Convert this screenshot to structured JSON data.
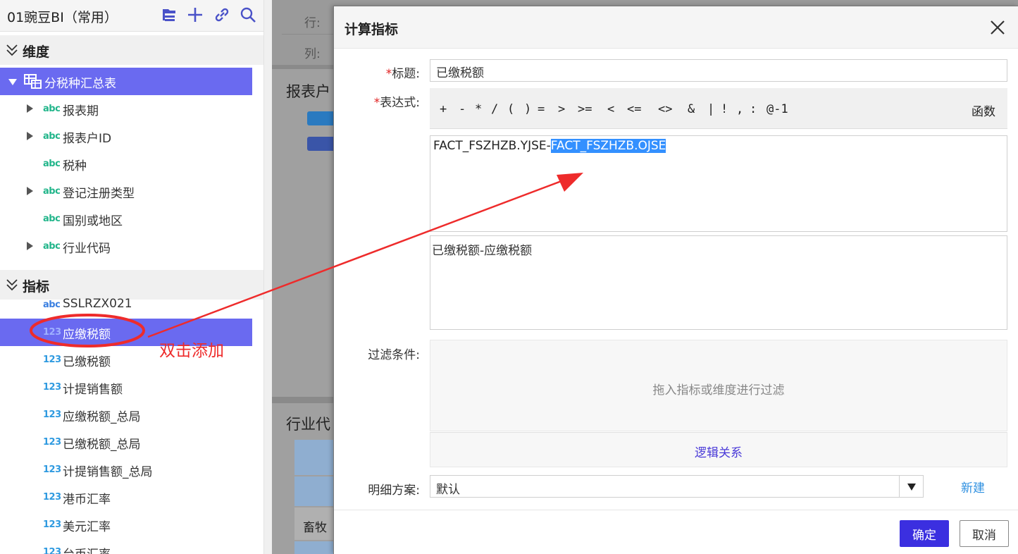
{
  "sidebar": {
    "title": "01豌豆BI（常用）",
    "icons": [
      "folder-tree-icon",
      "plus-icon",
      "link-icon",
      "search-icon"
    ],
    "dimension_header": "维度",
    "table_name": "分税种汇总表",
    "dimension_items": [
      {
        "type": "abc",
        "label": "报表期",
        "expandable": true
      },
      {
        "type": "abc",
        "label": "报表户ID",
        "expandable": true
      },
      {
        "type": "abc",
        "label": "税种",
        "expandable": false
      },
      {
        "type": "abc",
        "label": "登记注册类型",
        "expandable": true
      },
      {
        "type": "abc",
        "label": "国别或地区",
        "expandable": false
      },
      {
        "type": "abc",
        "label": "行业代码",
        "expandable": true
      }
    ],
    "measure_header": "指标",
    "measure_items": [
      {
        "type": "abc",
        "label": "SSLRZX021"
      },
      {
        "type": "123",
        "label": "应缴税额",
        "selected": true
      },
      {
        "type": "123",
        "label": "已缴税额"
      },
      {
        "type": "123",
        "label": "计提销售额"
      },
      {
        "type": "123",
        "label": "应缴税额_总局"
      },
      {
        "type": "123",
        "label": "已缴税额_总局"
      },
      {
        "type": "123",
        "label": "计提销售额_总局"
      },
      {
        "type": "123",
        "label": "港币汇率"
      },
      {
        "type": "123",
        "label": "美元汇率"
      },
      {
        "type": "123",
        "label": "台币汇率"
      }
    ]
  },
  "background": {
    "row_label": "行:",
    "col_label": "列:",
    "panel1_title": "报表户",
    "panel2_title": "行业代",
    "cell_text": "畜牧"
  },
  "dialog": {
    "title": "计算指标",
    "title_label": "标题:",
    "title_value": "已缴税额",
    "expr_label": "表达式:",
    "operators": [
      "+",
      "-",
      "*",
      "/",
      "(",
      ")",
      "=",
      ">",
      ">=",
      "<",
      "<=",
      "<>",
      "&",
      "|",
      "!",
      ",",
      ":",
      "@-1"
    ],
    "functions_label": "函数",
    "expression_plain": "FACT_FSZHZB.YJSE-",
    "expression_selected": "FACT_FSZHZB.OJSE",
    "description": "已缴税额-应缴税额",
    "filter_label": "过滤条件:",
    "filter_placeholder": "拖入指标或维度进行过滤",
    "logic_link": "逻辑关系",
    "detail_label": "明细方案:",
    "detail_value": "默认",
    "new_link": "新建",
    "ok_label": "确定",
    "cancel_label": "取消"
  },
  "annotation": {
    "text": "双击添加",
    "color": "#ee2b2b"
  },
  "colors": {
    "accent": "#3b2fe0",
    "selected_row": "#6a6af0",
    "link": "#2f90e0"
  }
}
